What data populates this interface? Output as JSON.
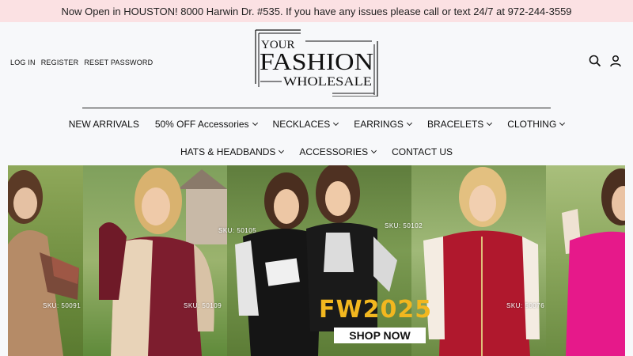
{
  "announcement": "Now Open in HOUSTON! 8000 Harwin Dr. #535. If you have any issues please call or text 24/7 at 972-244-3559",
  "account_links": [
    "LOG IN",
    "REGISTER",
    "RESET PASSWORD"
  ],
  "logo": {
    "line1": "YOUR",
    "line2": "FASHION",
    "line3": "WHOLESALE"
  },
  "header_icons": [
    "search-icon",
    "user-icon"
  ],
  "nav_row1": [
    {
      "label": "NEW ARRIVALS",
      "dropdown": false
    },
    {
      "label": "50% OFF Accessories",
      "dropdown": true
    },
    {
      "label": "NECKLACES",
      "dropdown": true
    },
    {
      "label": "EARRINGS",
      "dropdown": true
    },
    {
      "label": "BRACELETS",
      "dropdown": true
    },
    {
      "label": "CLOTHING",
      "dropdown": true
    }
  ],
  "nav_row2": [
    {
      "label": "HATS & HEADBANDS",
      "dropdown": true
    },
    {
      "label": "ACCESSORIES",
      "dropdown": true
    },
    {
      "label": "CONTACT US",
      "dropdown": false
    }
  ],
  "hero": {
    "skus": [
      "SKU: 50091",
      "SKU: 50109",
      "SKU: 50105",
      "SKU: 50102",
      "SKU: 50076"
    ],
    "headline": "FW2025",
    "cta": "SHOP NOW"
  },
  "colors": {
    "announcement_bg": "#fbe1e3",
    "accent": "#f2b71f"
  }
}
